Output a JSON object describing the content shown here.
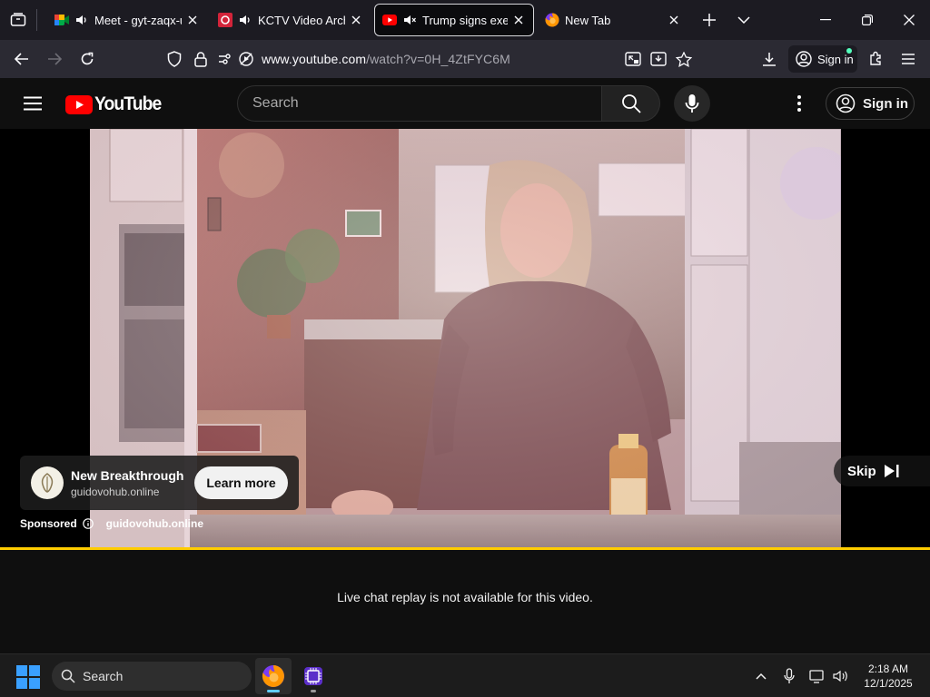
{
  "browser": {
    "tabs": [
      {
        "title": "Meet - gyt-zaqx-uh",
        "favicon": "google-meet-icon",
        "audio": "speaker-icon",
        "active": false
      },
      {
        "title": "KCTV Video Archive",
        "favicon": "kctv-icon",
        "audio": "speaker-icon",
        "active": false
      },
      {
        "title": "Trump signs executive",
        "favicon": "youtube-icon",
        "audio": "speaker-muted-icon",
        "active": true
      },
      {
        "title": "New Tab",
        "favicon": "firefox-icon",
        "audio": "",
        "active": false
      }
    ],
    "url": {
      "domain": "www.youtube.com",
      "path": "/watch?v=0H_4ZtFYC6M"
    },
    "signin_label": "Sign in"
  },
  "youtube": {
    "logo_text": "YouTube",
    "search_placeholder": "Search",
    "signin_label": "Sign in"
  },
  "ad": {
    "title": "New Breakthrough",
    "domain": "guidovohub.online",
    "cta": "Learn more",
    "sponsored_label": "Sponsored",
    "sponsored_domain": "guidovohub.online",
    "skip_label": "Skip",
    "progress_fraction": 1.0
  },
  "chat": {
    "message": "Live chat replay is not available for this video."
  },
  "taskbar": {
    "search_label": "Search",
    "time": "2:18 AM",
    "date": "12/1/2025"
  },
  "colors": {
    "accent_progress": "#ffcc00",
    "youtube_red": "#ff0000",
    "firefox_tab_bg": "#1c1b22",
    "navbar_bg": "#2b2a33"
  }
}
